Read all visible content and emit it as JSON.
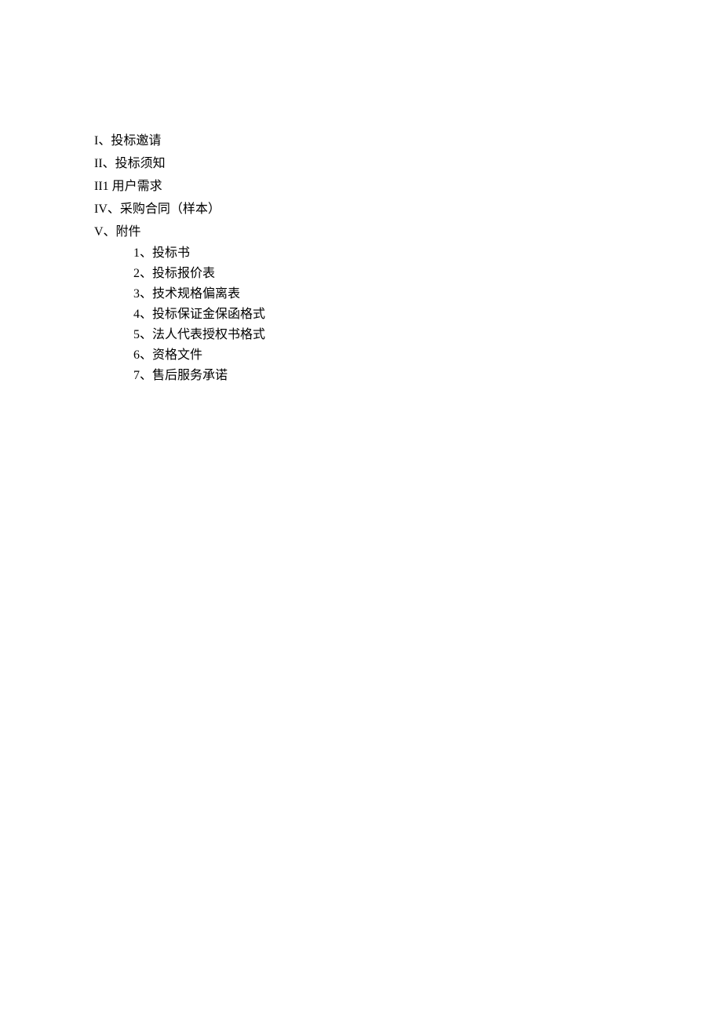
{
  "toc": {
    "items": [
      "I、投标邀请",
      "II、投标须知",
      "II1 用户需求",
      "IV、采购合同（样本）",
      "V、附件"
    ],
    "subItems": [
      "1、投标书",
      "2、投标报价表",
      "3、技术规格偏离表",
      "4、投标保证金保函格式",
      "5、法人代表授权书格式",
      "6、资格文件",
      "7、售后服务承诺"
    ]
  }
}
